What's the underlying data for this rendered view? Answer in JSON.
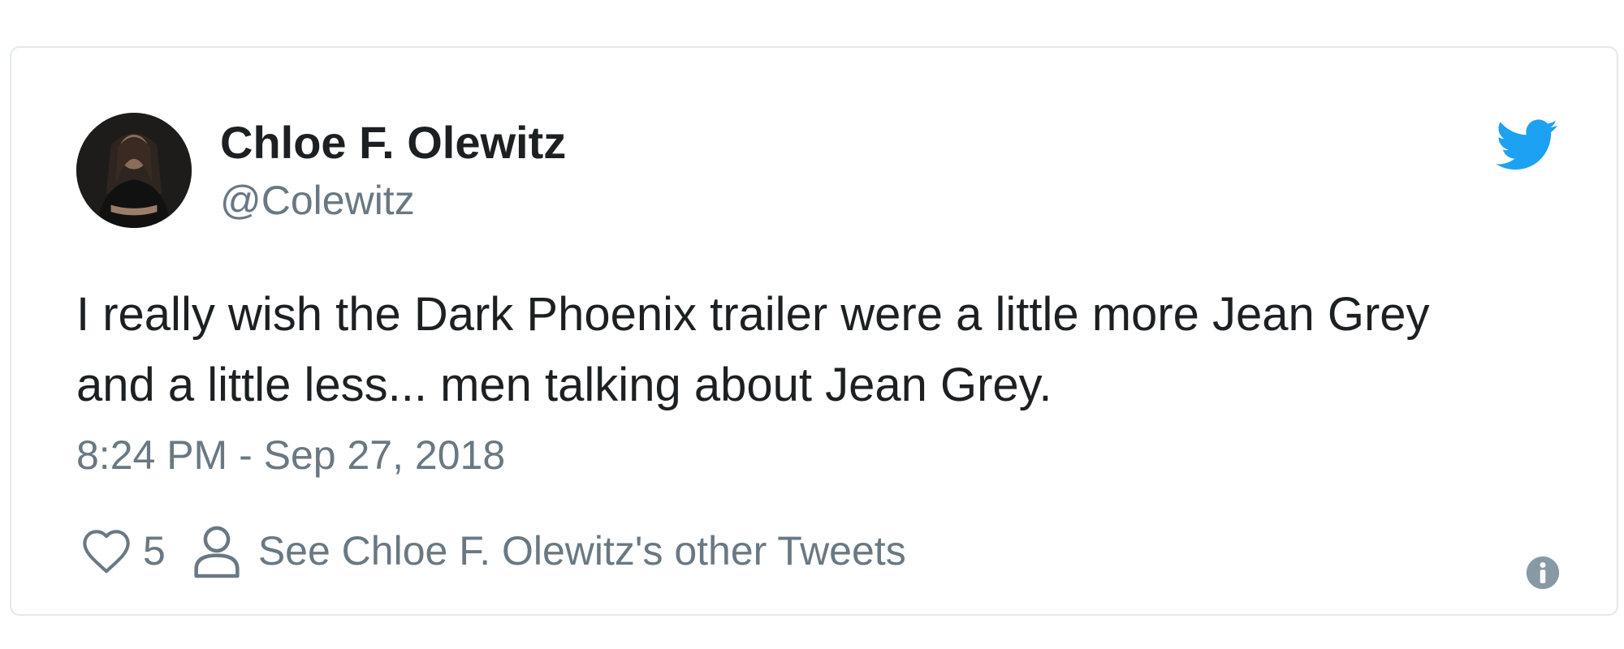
{
  "tweet": {
    "author": {
      "display_name": "Chloe F. Olewitz",
      "handle": "@Colewitz"
    },
    "text": "I really wish the Dark Phoenix trailer were a little more Jean Grey and a little less... men talking about Jean Grey.",
    "timestamp": "8:24 PM - Sep 27, 2018",
    "actions": {
      "like_count": "5",
      "profile_link_label": "See Chloe F. Olewitz's other Tweets"
    }
  },
  "icons": {
    "brand": "twitter-bird-icon",
    "like": "heart-icon",
    "profile": "person-icon",
    "info": "info-icon"
  },
  "colors": {
    "brand_blue": "#1da1f2",
    "text_primary": "#1c2022",
    "text_secondary": "#697882",
    "card_border": "#e1e8ed"
  }
}
